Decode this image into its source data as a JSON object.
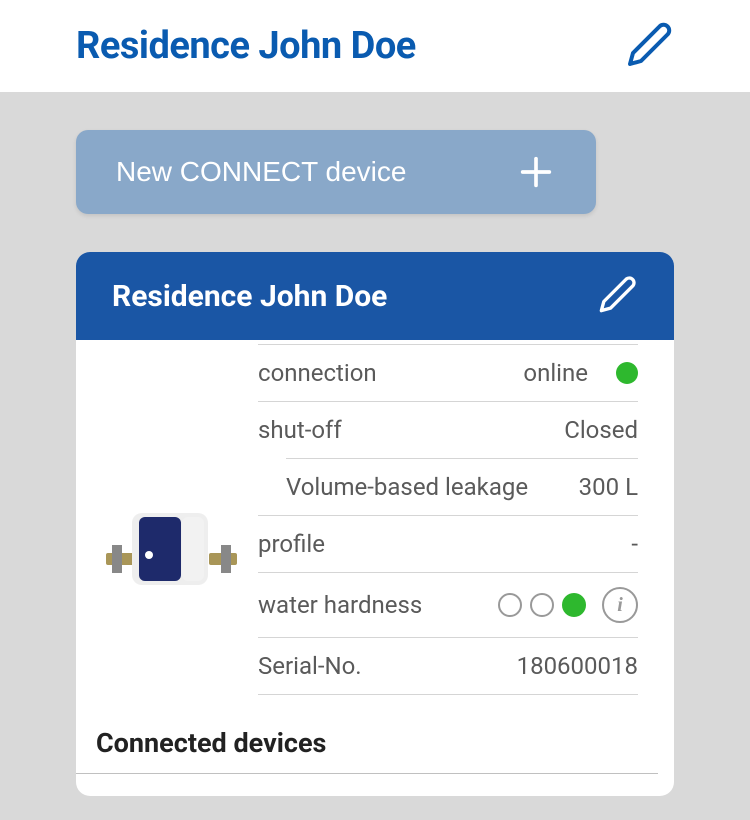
{
  "page": {
    "title": "Residence John Doe"
  },
  "newDevice": {
    "label": "New CONNECT device"
  },
  "card": {
    "title": "Residence John Doe",
    "rows": {
      "connection": {
        "label": "connection",
        "value": "online"
      },
      "shutoff": {
        "label": "shut-off",
        "value": "Closed"
      },
      "leakage": {
        "label": "Volume-based leakage",
        "value": "300 L"
      },
      "profile": {
        "label": "profile",
        "value": "-"
      },
      "hardness": {
        "label": "water hardness"
      },
      "serial": {
        "label": "Serial-No.",
        "value": "180600018"
      }
    }
  },
  "connected": {
    "title": "Connected devices"
  }
}
